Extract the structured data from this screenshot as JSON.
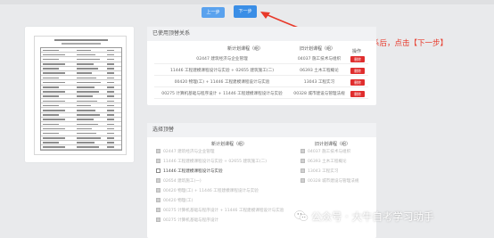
{
  "nav": {
    "prev_label": "上一步",
    "next_label": "下一步"
  },
  "annotation": {
    "text": "选择好顶替关系后，点击【下一步】",
    "color": "#e8392a"
  },
  "used": {
    "title": "已使用顶替关系",
    "col_plan": "新计划课程（组）",
    "col_old": "旧计划课程（组）",
    "col_op": "操作",
    "rows": [
      {
        "plan": "02447 建筑经济与企业管理",
        "old": "04037 施工技术与组织",
        "op": "删除"
      },
      {
        "plan": "11446 工程建模课程设计与实验 + 02655 建筑施工(二)",
        "old": "06393 土木工程概论",
        "op": "删除"
      },
      {
        "plan": "00420 物理(工) + 11446 工程建模课程设计与实验",
        "old": "13043 工程实习",
        "op": "删除"
      },
      {
        "plan": "00275 计算机基础与程序设计 + 11446 工程建模课程设计与实验",
        "old": "00328 城市建设与管理法规",
        "op": "删除"
      }
    ]
  },
  "select": {
    "title": "选择顶替",
    "col_plan": "新计划课程（组）",
    "col_old": "旧计划课程（组）",
    "left": [
      {
        "label": "02447 建筑经济与企业管理",
        "state": "checked"
      },
      {
        "label": "11446 工程建模课程设计与实验 + 02655 建筑施工(二)",
        "state": "checked"
      },
      {
        "label": "11446 工程建模课程设计与实验",
        "state": "empty"
      },
      {
        "label": "02654 建筑施工(一)",
        "state": "checked"
      },
      {
        "label": "00420 物理(工) + 11446 工程建模课程设计与实验",
        "state": "checked"
      },
      {
        "label": "00420 物理(工)",
        "state": "checked"
      },
      {
        "label": "00275 计算机基础与程序设计 + 11446 工程建模课程设计与实验",
        "state": "checked"
      },
      {
        "label": "00275 计算机基础与程序设计",
        "state": "checked"
      }
    ],
    "right": [
      {
        "label": "04037 施工技术与组织",
        "state": "checked"
      },
      {
        "label": "06393 土木工程概论",
        "state": "checked"
      },
      {
        "label": "13043 工程实习",
        "state": "checked"
      },
      {
        "label": "00328 城市建设与管理法规",
        "state": "checked"
      }
    ]
  },
  "watermark": {
    "text": "公众号 · 大牛自考学习助手"
  }
}
